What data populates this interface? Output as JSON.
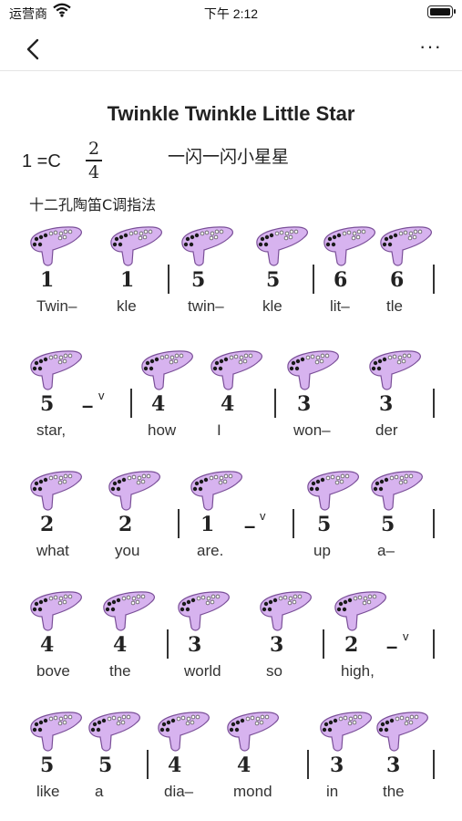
{
  "status": {
    "carrier": "运营商",
    "time": "下午 2:12"
  },
  "nav": {
    "back_icon": "chevron-left-icon",
    "more_label": "···"
  },
  "song": {
    "title": "Twinkle Twinkle Little Star",
    "key": "1 =C",
    "time_top": "2",
    "time_bottom": "4",
    "cn_title": "一闪一闪小星星",
    "fingering": "十二孔陶笛C调指法"
  },
  "colors": {
    "ocarina_fill": "#d7b3ef",
    "ocarina_stroke": "#7a4f98"
  },
  "rows": [
    {
      "notes": [
        {
          "digit": "1",
          "lyric": "Twin–"
        },
        {
          "digit": "1",
          "lyric": "kle"
        },
        {
          "digit": "5",
          "lyric": "twin–"
        },
        {
          "digit": "5",
          "lyric": "kle"
        },
        {
          "digit": "6",
          "lyric": "lit–"
        },
        {
          "digit": "6",
          "lyric": "tle"
        }
      ]
    },
    {
      "notes": [
        {
          "digit": "5",
          "lyric": "star,"
        },
        {
          "digit": "4",
          "lyric": "how"
        },
        {
          "digit": "4",
          "lyric": "I"
        },
        {
          "digit": "3",
          "lyric": "won–"
        },
        {
          "digit": "3",
          "lyric": "der"
        }
      ]
    },
    {
      "notes": [
        {
          "digit": "2",
          "lyric": "what"
        },
        {
          "digit": "2",
          "lyric": "you"
        },
        {
          "digit": "1",
          "lyric": "are."
        },
        {
          "digit": "5",
          "lyric": "up"
        },
        {
          "digit": "5",
          "lyric": "a–"
        }
      ]
    },
    {
      "notes": [
        {
          "digit": "4",
          "lyric": "bove"
        },
        {
          "digit": "4",
          "lyric": "the"
        },
        {
          "digit": "3",
          "lyric": "world"
        },
        {
          "digit": "3",
          "lyric": "so"
        },
        {
          "digit": "2",
          "lyric": "high,"
        }
      ]
    },
    {
      "notes": [
        {
          "digit": "5",
          "lyric": "like"
        },
        {
          "digit": "5",
          "lyric": "a"
        },
        {
          "digit": "4",
          "lyric": "dia–"
        },
        {
          "digit": "4",
          "lyric": "mond"
        },
        {
          "digit": "3",
          "lyric": "in"
        },
        {
          "digit": "3",
          "lyric": "the"
        }
      ]
    }
  ],
  "symbols": {
    "dash": "–",
    "breath": "v"
  }
}
